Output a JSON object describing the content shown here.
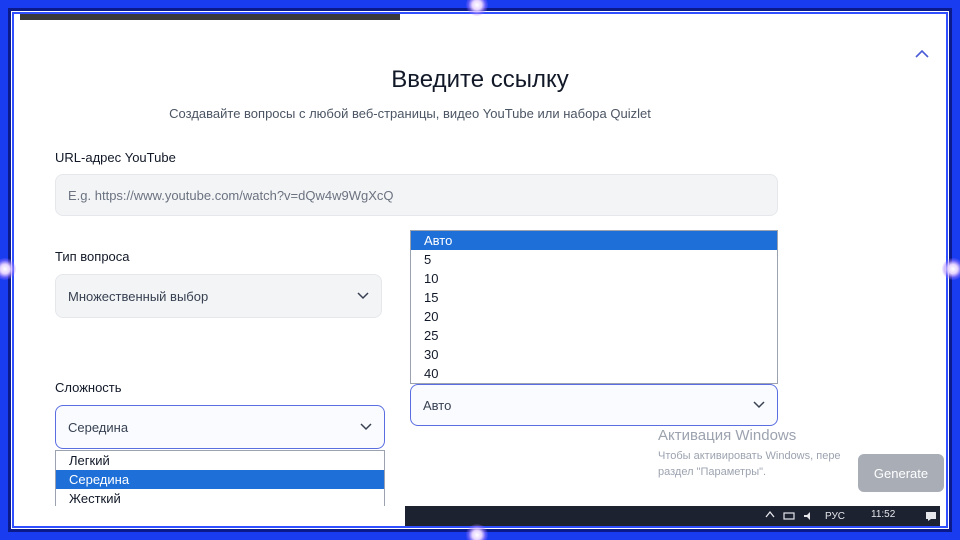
{
  "header": {
    "title": "Введите ссылку",
    "subtitle": "Создавайте вопросы с любой веб-страницы, видео YouTube или набора Quizlet"
  },
  "youtube": {
    "label": "URL-адрес YouTube",
    "placeholder": "E.g. https://www.youtube.com/watch?v=dQw4w9WgXcQ"
  },
  "question_type": {
    "label": "Тип вопроса",
    "value": "Множественный выбор"
  },
  "difficulty": {
    "label": "Сложность",
    "value": "Середина",
    "options": [
      "Легкий",
      "Середина",
      "Жесткий"
    ],
    "selected_index": 1
  },
  "count": {
    "value": "Авто",
    "options": [
      "Авто",
      "5",
      "10",
      "15",
      "20",
      "25",
      "30",
      "40"
    ],
    "selected_index": 0
  },
  "watermark": {
    "title": "Активация Windows",
    "line1": "Чтобы активировать Windows, пере",
    "line2": "раздел \"Параметры\"."
  },
  "actions": {
    "generate_label": "Generate"
  },
  "taskbar": {
    "language": "РУС",
    "time": "11:52"
  },
  "icons": {
    "collapse": "chevron-up-icon",
    "select_arrow": "chevron-down-icon",
    "notifications": "notification-icon"
  },
  "colors": {
    "frame": "#1a3cf0",
    "selected_option": "#1f6fd8",
    "generate_button": "#a8adb6"
  }
}
